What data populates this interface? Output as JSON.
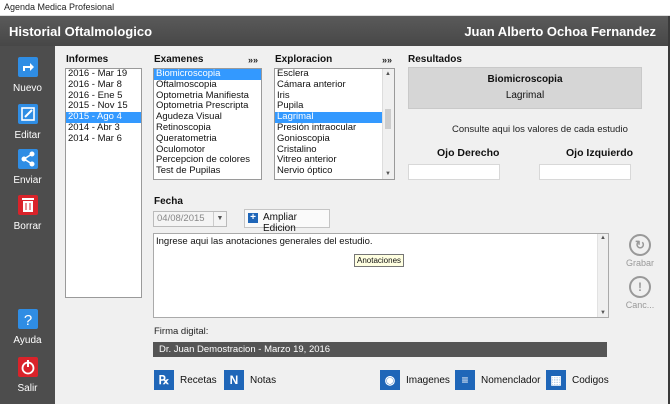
{
  "window": {
    "title": "Agenda Medica Profesional"
  },
  "header": {
    "title": "Historial Oftalmologico",
    "patient": "Juan Alberto Ochoa Fernandez"
  },
  "sidebar": {
    "top": [
      {
        "label": "Nuevo",
        "icon": "new-icon"
      },
      {
        "label": "Editar",
        "icon": "edit-icon"
      },
      {
        "label": "Enviar",
        "icon": "share-icon"
      },
      {
        "label": "Borrar",
        "icon": "trash-icon"
      }
    ],
    "bottom": [
      {
        "label": "Ayuda",
        "icon": "help-icon"
      },
      {
        "label": "Salir",
        "icon": "power-icon"
      }
    ]
  },
  "informes": {
    "heading": "Informes",
    "items": [
      "2016 - Mar 19",
      "2016 - Mar 8",
      "2016 - Ene 5",
      "2015 - Nov 15",
      "2015 - Ago 4",
      "2014 - Abr 3",
      "2014 - Mar 6"
    ],
    "selected": 4
  },
  "examenes": {
    "heading": "Examenes",
    "arrows": "»»",
    "items": [
      "Biomicroscopia",
      "Oftalmoscopia",
      "Optometria Manifiesta",
      "Optometria Prescripta",
      "Agudeza Visual",
      "Retinoscopia",
      "Queratometria",
      "Oculomotor",
      "Percepcion de colores",
      "Test de Pupilas"
    ],
    "selected": 0
  },
  "exploracion": {
    "heading": "Exploracion",
    "arrows": "»»",
    "items": [
      "Esclera",
      "Cámara anterior",
      "Iris",
      "Pupila",
      "Lagrimal",
      "Presión intraocular",
      "Gonioscopia",
      "Cristalino",
      "Vitreo anterior",
      "Nervio óptico"
    ],
    "selected": 4
  },
  "resultados": {
    "heading": "Resultados",
    "exam": "Biomicroscopia",
    "area": "Lagrimal",
    "hint": "Consulte aqui los valores de cada estudio",
    "od_label": "Ojo Derecho",
    "oi_label": "Ojo Izquierdo",
    "od_value": "",
    "oi_value": ""
  },
  "fecha": {
    "label": "Fecha",
    "value": "04/08/2015",
    "expand_label": "Ampliar Edicion"
  },
  "notes": {
    "text": "Ingrese aqui las anotaciones generales del estudio.",
    "tooltip": "Anotaciones"
  },
  "actions": {
    "save": "Grabar",
    "cancel": "Canc..."
  },
  "firma": {
    "label": "Firma digital:",
    "value": "Dr. Juan Demostracion - Marzo 19, 2016"
  },
  "toolbar": {
    "recetas": "Recetas",
    "notas": "Notas",
    "imagenes": "Imagenes",
    "nomenclador": "Nomenclador",
    "codigos": "Codigos"
  },
  "colors": {
    "accent": "#1f66b8",
    "selection": "#3399ff",
    "sidebar": "#4d4d4d",
    "exit": "#d9232a"
  }
}
